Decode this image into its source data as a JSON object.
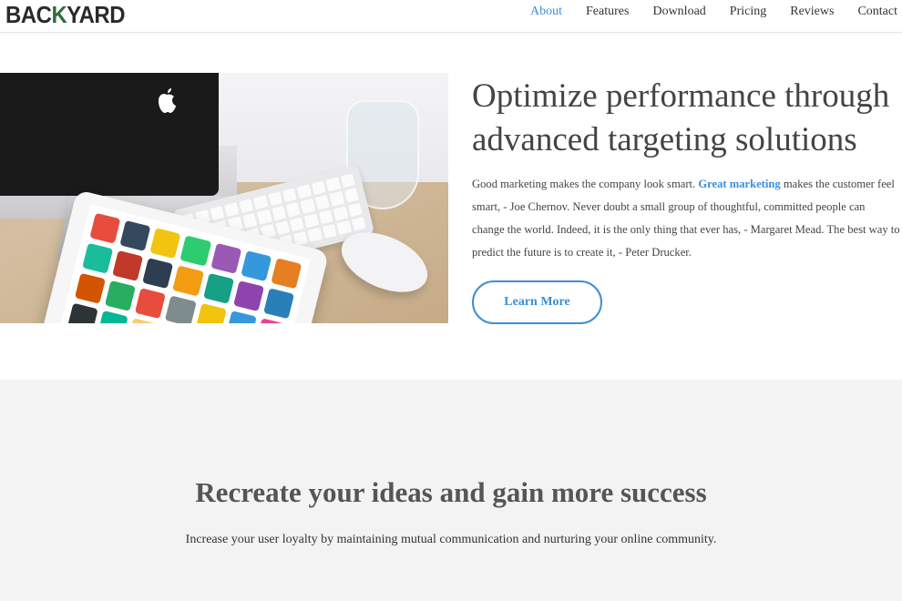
{
  "header": {
    "logo": {
      "part1": "BAC",
      "accent": "K",
      "part2": "YARD"
    },
    "nav": [
      "About",
      "Features",
      "Download",
      "Pricing",
      "Reviews",
      "Contact"
    ],
    "active_nav": "About"
  },
  "hero": {
    "title": "Optimize performance through advanced targeting solutions",
    "text_before": "Good marketing makes the company look smart. ",
    "text_highlight": "Great marketing",
    "text_after": " makes the customer feel smart, - Joe Chernov. Never doubt a small group of thoughtful, committed people can change the world. Indeed, it is the only thing that ever has, - Margaret Mead. The best way to predict the future is to create it, - Peter Drucker.",
    "button_label": "Learn More"
  },
  "section2": {
    "title": "Recreate your ideas and gain more success",
    "text": "Increase your user loyalty by maintaining mutual communication and nurturing your online community."
  },
  "colors": {
    "accent": "#3b8fd8",
    "section_bg": "#f3f3f3"
  }
}
